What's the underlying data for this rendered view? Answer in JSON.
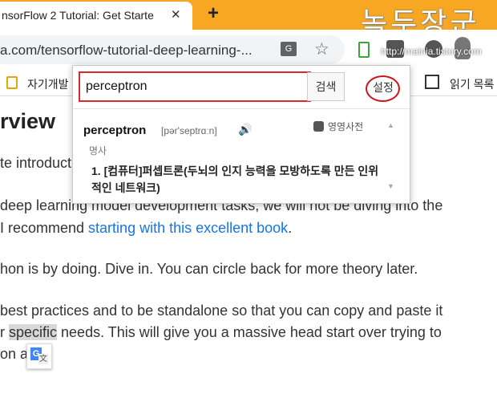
{
  "browser": {
    "tab_title": "nsorFlow 2 Tutorial: Get Starte",
    "tab_close": "✕",
    "new_tab": "+",
    "url": "a.com/tensorflow-tutorial-deep-learning-...",
    "translate_icon_glyph": "G",
    "star_glyph": "☆",
    "bookmark_folder": "자기개발",
    "bookmark_reading_list": "읽기 목록"
  },
  "watermark": {
    "main": "녹두장군",
    "sub": "http://mainia.tistory.com"
  },
  "page": {
    "heading": "rview",
    "lines": [
      {
        "text": "te introduct"
      },
      {
        "text": "deep learning model development tasks, we will not be diving into the"
      },
      {
        "pre": " I recommend ",
        "link": "starting with this excellent book",
        "post": "."
      },
      {
        "text": "hon is by doing. Dive in. You can circle back for more theory later."
      },
      {
        "text": "best practices and to be standalone so that you can copy and paste it"
      },
      {
        "pre": "r ",
        "hl": "specific",
        "post": " needs. This will give you a massive head start over trying to"
      },
      {
        "text": "on a   e."
      }
    ]
  },
  "dictionary_popup": {
    "search_value": "perceptron",
    "search_button": "검색",
    "settings_button": "설정",
    "headword": "perceptron",
    "pronunciation": "[pər'septrɑːn]",
    "speaker_glyph": "🔊",
    "dictionary_name": "영영사전",
    "part_of_speech": "명사",
    "definition": "1. [컴퓨터]퍼셉트론(두뇌의 인지 능력을 모방하도록 만든 인위적인 네트워크)",
    "scroll_up_glyph": "▲",
    "scroll_down_glyph": "▼"
  },
  "colors": {
    "tab_strip": "#f7a721",
    "highlight_ring": "#d0121b",
    "input_border": "#e0262b",
    "link": "#1a73e8"
  },
  "icons": [
    "translate-icon",
    "star-icon",
    "extension-icon",
    "folder-icon",
    "reading-list-icon",
    "speaker-icon",
    "google-translate-icon"
  ]
}
